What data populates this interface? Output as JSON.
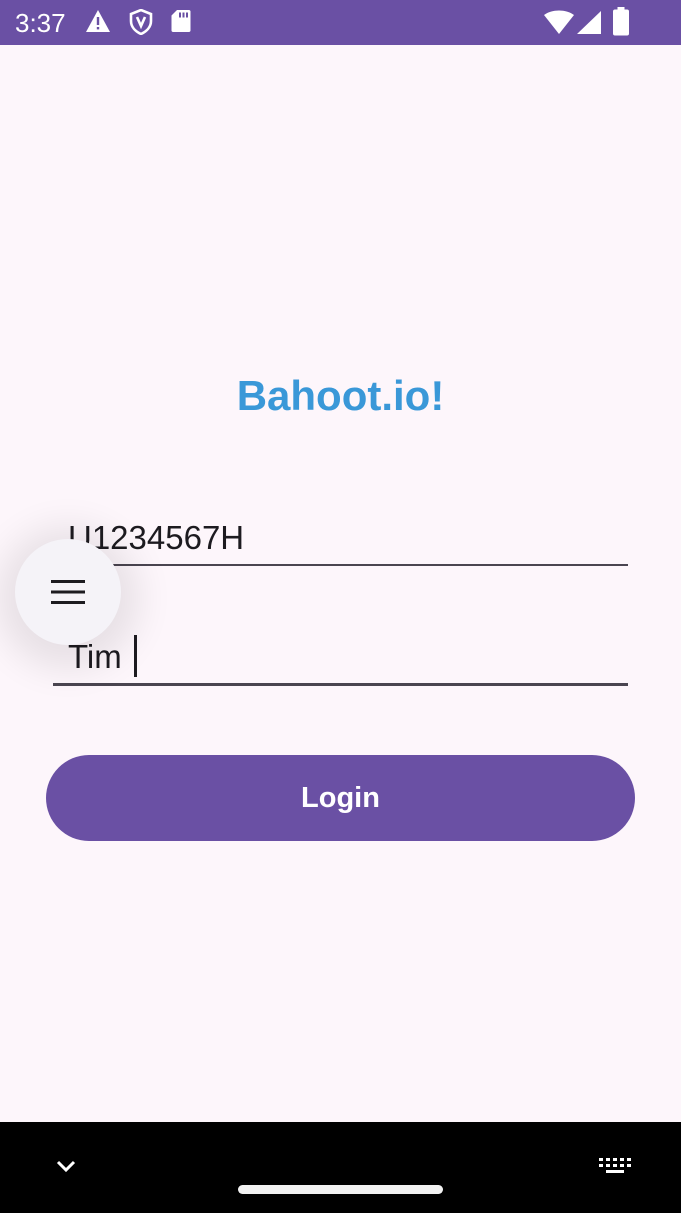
{
  "status_bar": {
    "time": "3:37",
    "left_icons": [
      "warning-icon",
      "shield-icon",
      "sd-card-icon"
    ],
    "right_icons": [
      "wifi-icon",
      "cell-signal-icon",
      "battery-icon"
    ],
    "color": "#6a50a4"
  },
  "app": {
    "title": "Bahoot.io!",
    "title_color": "#3a98d8",
    "user_id_value": "U1234567H",
    "name_value": "Tim",
    "login_label": "Login",
    "accent_color": "#6a50a4",
    "background": "#fdf6fb"
  },
  "fab": {
    "icon": "menu-icon"
  },
  "nav_bar": {
    "icons": [
      "chevron-down-icon",
      "keyboard-icon",
      "home-handle"
    ],
    "color": "#000000"
  }
}
